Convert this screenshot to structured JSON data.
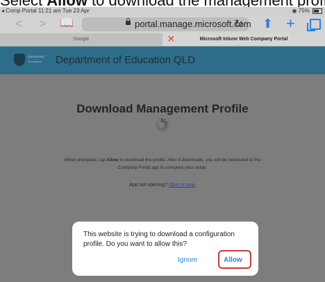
{
  "caption": {
    "prefix": "Select ",
    "bold": "Allow",
    "suffix": " to download the management profile."
  },
  "status_bar": {
    "back_app": "◂ Comp Portal",
    "time": "11:21 am",
    "date": "Tue 23 Apr",
    "battery": "75%"
  },
  "toolbar": {
    "url": "portal.manage.microsoft.com",
    "icons": [
      "back-icon",
      "forward-icon",
      "bookmarks-icon",
      "lock-icon",
      "reload-icon",
      "share-icon",
      "new-tab-icon",
      "tabs-icon"
    ]
  },
  "tabs": [
    {
      "label": "Google"
    },
    {
      "label": "Microsoft Intune Web Company Portal"
    }
  ],
  "header": {
    "logo_text": "Queensland",
    "logo_sub": "Government",
    "title": "Department of Education QLD"
  },
  "main": {
    "heading": "Download Management Profile",
    "instructions_1": "When prompted, tap ",
    "instructions_bold": "Allow",
    "instructions_2": " to download the profile. After it downloads, you will be redirected to the",
    "instructions_3": "Company Portal app to complete your setup.",
    "not_opening": "App not opening? ",
    "open_link": "Open it now."
  },
  "dialog": {
    "message": "This website is trying to download a configuration profile. Do you want to allow this?",
    "ignore_label": "Ignore",
    "allow_label": "Allow"
  },
  "colors": {
    "header_bg": "#2e6d8a",
    "accent": "#2a7fe0",
    "highlight": "#c43a3a",
    "overlay": "#7d7d7d"
  }
}
